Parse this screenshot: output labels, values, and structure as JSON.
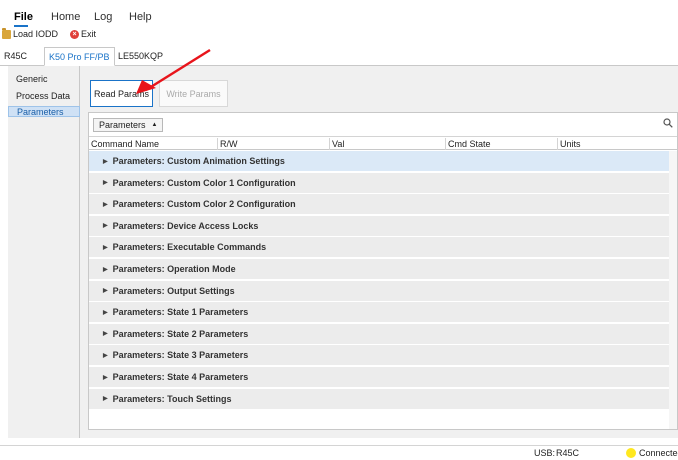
{
  "menu": {
    "items": [
      {
        "label": "File",
        "active": true
      },
      {
        "label": "Home"
      },
      {
        "label": "Log"
      },
      {
        "label": "Help"
      }
    ]
  },
  "toolbar": {
    "load_iodd": "Load IODD",
    "exit": "Exit"
  },
  "device_tabs": [
    "R45C",
    "K50 Pro FF/PB",
    "LE550KQP"
  ],
  "active_device_tab": "K50 Pro FF/PB",
  "side_nav": {
    "items": [
      "Generic",
      "Process Data",
      "Parameters"
    ],
    "active": "Parameters"
  },
  "actions": {
    "read_params": "Read Params",
    "write_params": "Write Params"
  },
  "grid": {
    "group_by": "Parameters",
    "columns": [
      "Command Name",
      "R/W",
      "Val",
      "Cmd State",
      "Units"
    ],
    "groups": [
      "Parameters: Custom Animation Settings",
      "Parameters: Custom Color 1 Configuration",
      "Parameters: Custom Color 2 Configuration",
      "Parameters: Device Access Locks",
      "Parameters: Executable Commands",
      "Parameters: Operation Mode",
      "Parameters: Output Settings",
      "Parameters: State 1 Parameters",
      "Parameters: State 2 Parameters",
      "Parameters: State 3 Parameters",
      "Parameters: State 4 Parameters",
      "Parameters: Touch Settings"
    ]
  },
  "status": {
    "connection_label": "USB:",
    "connection_device": "R45C",
    "state": "Connected",
    "state_color": "#ffe81f"
  },
  "colors": {
    "accent": "#1a73c8",
    "annotation_arrow": "#e8141b"
  }
}
